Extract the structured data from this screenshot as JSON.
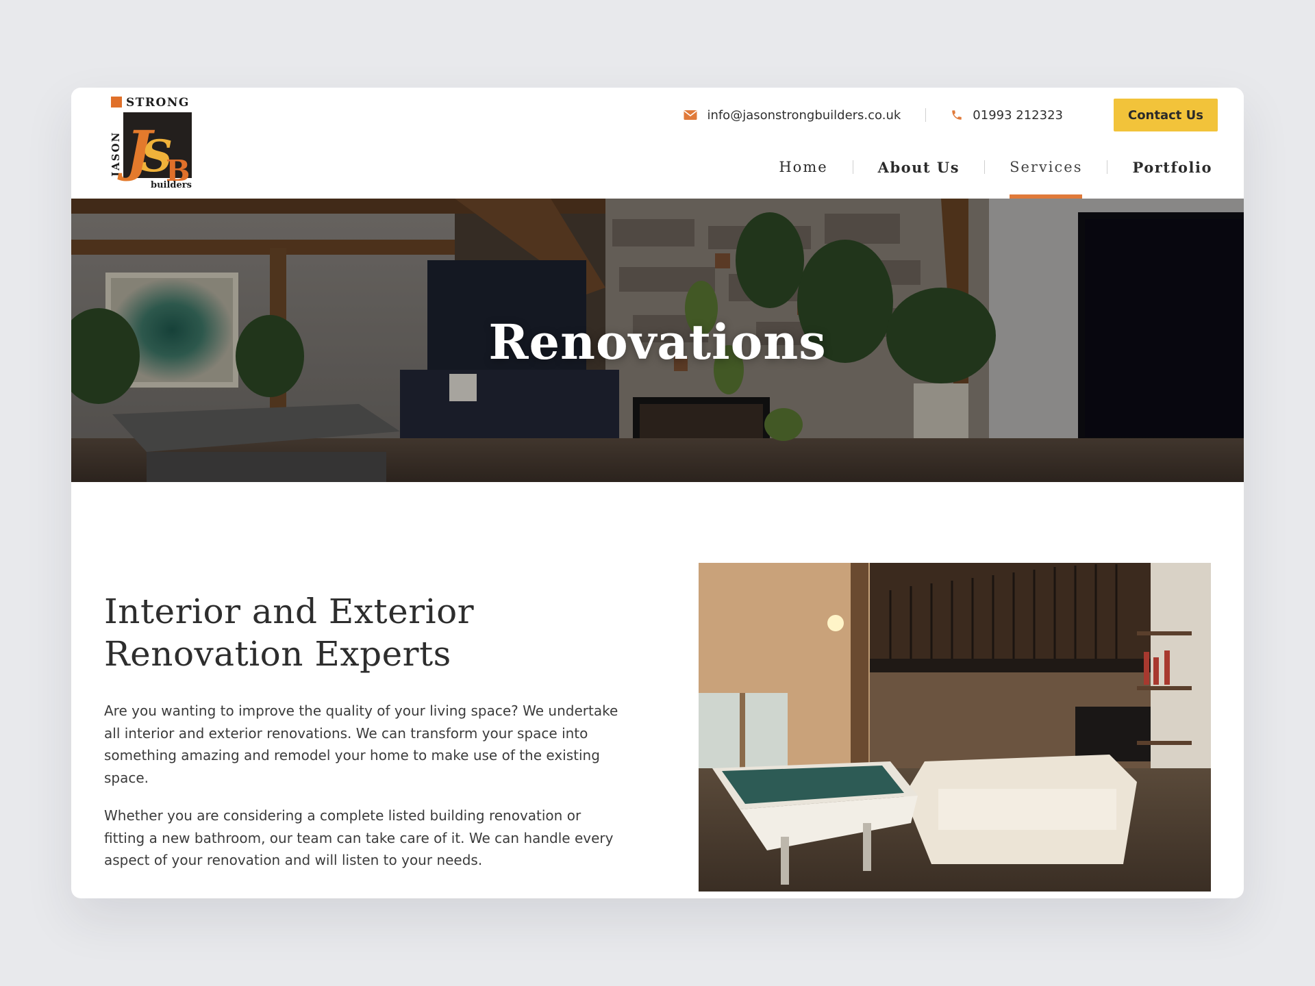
{
  "logo": {
    "text_top": "STRONG",
    "text_side": "JASON",
    "monogram": "JSB",
    "text_bottom": "builders"
  },
  "header": {
    "email": "info@jasonstrongbuilders.co.uk",
    "phone": "01993 212323",
    "contact_button": "Contact Us",
    "email_icon": "envelope-icon",
    "phone_icon": "phone-icon"
  },
  "nav": {
    "items": [
      {
        "label": "Home"
      },
      {
        "label": "About Us"
      },
      {
        "label": "Services"
      },
      {
        "label": "Portfolio"
      }
    ],
    "active": "Services"
  },
  "hero": {
    "title": "Renovations"
  },
  "content": {
    "heading": "Interior and Exterior Renovation Experts",
    "paragraphs": [
      "Are you wanting to improve the quality of your living space? We undertake all interior and exterior renovations. We can transform your space into something amazing and remodel your home to make use of the existing space.",
      "Whether you are considering a complete listed building renovation or fitting a new bathroom, our team can take care of it. We can handle every aspect of your renovation and will listen to your needs."
    ]
  },
  "colors": {
    "accent_orange": "#e07a3a",
    "button_yellow": "#f2c33a",
    "page_bg": "#e8e9ec"
  }
}
